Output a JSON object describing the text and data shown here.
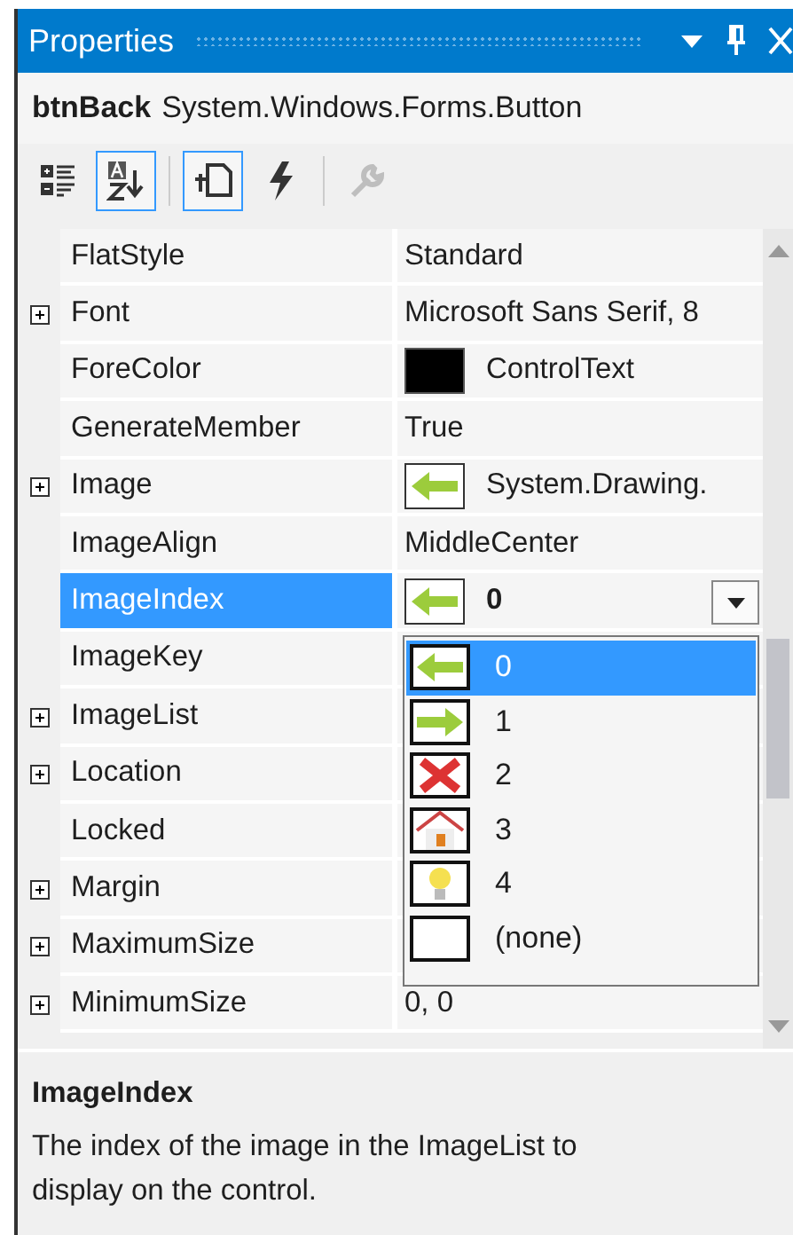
{
  "window": {
    "title": "Properties"
  },
  "object": {
    "name": "btnBack",
    "type": "System.Windows.Forms.Button"
  },
  "toolbar": [
    {
      "kind": "categorized",
      "selected": false,
      "disabled": false
    },
    {
      "kind": "alphabetical",
      "selected": true,
      "disabled": false
    },
    {
      "kind": "separator"
    },
    {
      "kind": "properties",
      "selected": true,
      "disabled": false
    },
    {
      "kind": "events",
      "selected": false,
      "disabled": false
    },
    {
      "kind": "separator"
    },
    {
      "kind": "property-pages",
      "selected": false,
      "disabled": true
    }
  ],
  "properties": [
    {
      "name": "FlatStyle",
      "value": "Standard",
      "expandable": false,
      "selected": false,
      "kind": "text"
    },
    {
      "name": "Font",
      "value": "Microsoft Sans Serif, 8",
      "expandable": true,
      "selected": false,
      "kind": "text"
    },
    {
      "name": "ForeColor",
      "value": "ControlText",
      "expandable": false,
      "selected": false,
      "kind": "color",
      "color": "#000000"
    },
    {
      "name": "GenerateMember",
      "value": "True",
      "expandable": false,
      "selected": false,
      "kind": "text"
    },
    {
      "name": "Image",
      "value": "System.Drawing.",
      "expandable": true,
      "selected": false,
      "kind": "image"
    },
    {
      "name": "ImageAlign",
      "value": "MiddleCenter",
      "expandable": false,
      "selected": false,
      "kind": "text"
    },
    {
      "name": "ImageIndex",
      "value": "0",
      "expandable": false,
      "selected": true,
      "kind": "combo"
    },
    {
      "name": "ImageKey",
      "expandable": false,
      "selected": false,
      "kind": "text"
    },
    {
      "name": "ImageList",
      "expandable": true,
      "selected": false,
      "kind": "text"
    },
    {
      "name": "Location",
      "expandable": true,
      "selected": false,
      "kind": "text"
    },
    {
      "name": "Locked",
      "expandable": false,
      "selected": false,
      "kind": "text"
    },
    {
      "name": "Margin",
      "expandable": true,
      "selected": false,
      "kind": "text"
    },
    {
      "name": "MaximumSize",
      "expandable": true,
      "selected": false,
      "kind": "text"
    },
    {
      "name": "MinimumSize",
      "value": "0, 0",
      "expandable": true,
      "selected": false,
      "kind": "text"
    }
  ],
  "dropdown": {
    "items": [
      {
        "label": "0",
        "kind": "left-arrow",
        "selected": true
      },
      {
        "label": "1",
        "kind": "right-arrow",
        "selected": false
      },
      {
        "label": "2",
        "kind": "cross",
        "selected": false
      },
      {
        "label": "3",
        "kind": "house",
        "selected": false
      },
      {
        "label": "4",
        "kind": "bulb",
        "selected": false
      },
      {
        "label": "(none)",
        "kind": "none",
        "selected": false
      }
    ]
  },
  "description": {
    "title": "ImageIndex",
    "text": "The index of the image in the ImageList to display on the control."
  }
}
